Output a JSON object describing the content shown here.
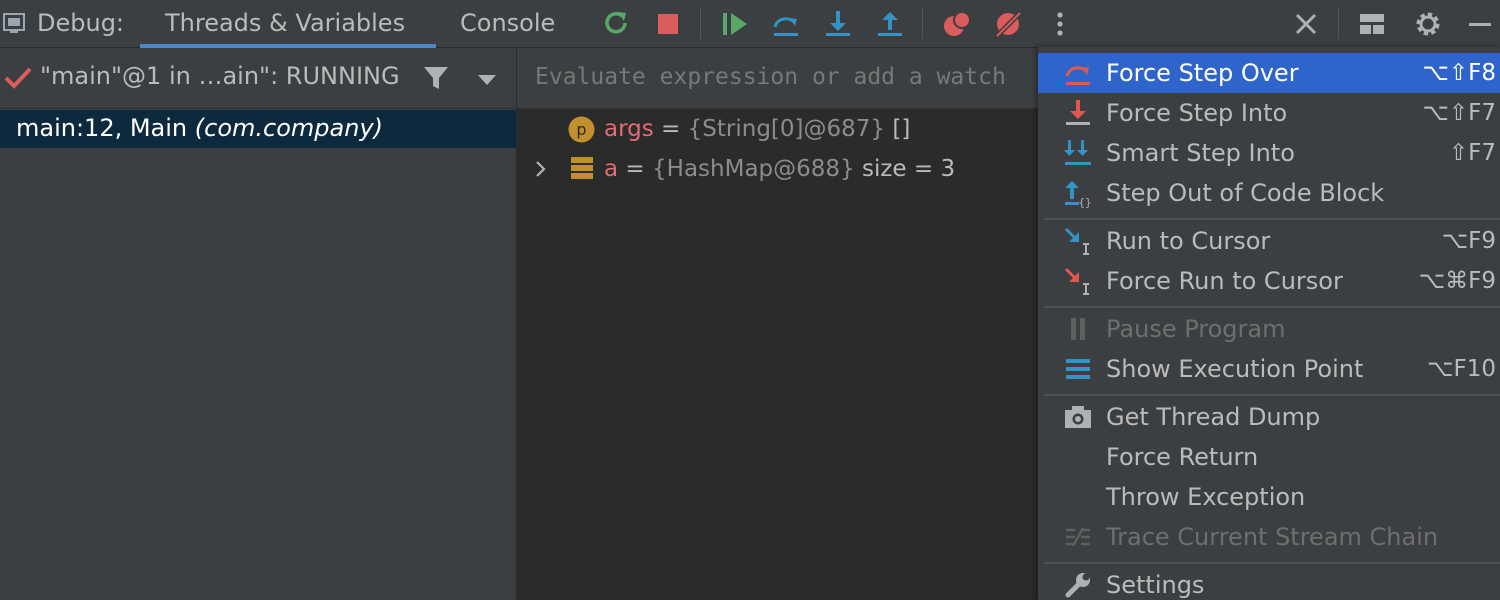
{
  "toolbar": {
    "debug_label": "Debug:",
    "tabs": [
      {
        "label": "Threads & Variables"
      },
      {
        "label": "Console"
      }
    ],
    "icons": [
      "rerun-icon",
      "stop-icon",
      "resume-icon",
      "step-over-icon",
      "step-into-icon",
      "step-out-icon",
      "view-breakpoints-icon",
      "mute-breakpoints-icon",
      "more-icon",
      "close-icon",
      "layout-icon",
      "gear-icon",
      "minimize-icon"
    ]
  },
  "threads": {
    "selected_thread": "\"main\"@1 in …ain\": RUNNING",
    "frames": [
      {
        "method": "main:12, Main",
        "package": "(com.company)"
      }
    ]
  },
  "evaluate": {
    "placeholder": "Evaluate expression or add a watch"
  },
  "variables": [
    {
      "name": "args",
      "eq": " = ",
      "value": "{String[0]@687}",
      "extra": " []",
      "icon": "param-icon"
    },
    {
      "name": "a",
      "eq": " = ",
      "value": "{HashMap@688}",
      "extra": "  size = 3",
      "icon": "field-icon"
    }
  ],
  "menu": {
    "items": [
      {
        "label": "Force Step Over",
        "shortcut": "⌥⇧F8"
      },
      {
        "label": "Force Step Into",
        "shortcut": "⌥⇧F7"
      },
      {
        "label": "Smart Step Into",
        "shortcut": "⇧F7"
      },
      {
        "label": "Step Out of Code Block",
        "shortcut": ""
      },
      {
        "label": "Run to Cursor",
        "shortcut": "⌥F9"
      },
      {
        "label": "Force Run to Cursor",
        "shortcut": "⌥⌘F9"
      },
      {
        "label": "Pause Program",
        "shortcut": ""
      },
      {
        "label": "Show Execution Point",
        "shortcut": "⌥F10"
      },
      {
        "label": "Get Thread Dump",
        "shortcut": ""
      },
      {
        "label": "Force Return",
        "shortcut": ""
      },
      {
        "label": "Throw Exception",
        "shortcut": ""
      },
      {
        "label": "Trace Current Stream Chain",
        "shortcut": ""
      },
      {
        "label": "Settings",
        "shortcut": ""
      }
    ]
  },
  "colors": {
    "accent": "#2f65ca",
    "tab_underline": "#4a88c7",
    "var_name": "#e06c75",
    "green": "#59a869",
    "red": "#db5c5c",
    "blue": "#3592c4"
  }
}
